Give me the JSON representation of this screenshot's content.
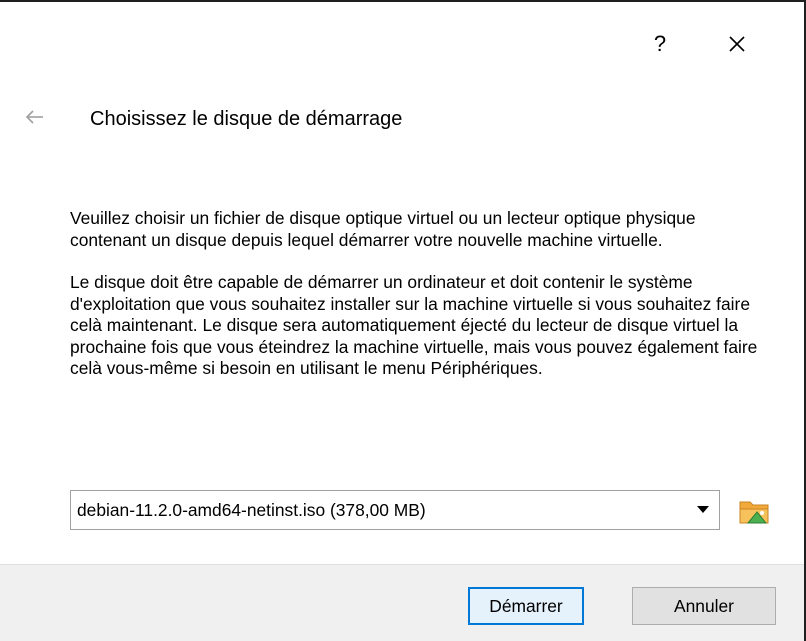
{
  "titlebar": {
    "help_label": "?"
  },
  "header": {
    "title": "Choisissez le disque de démarrage"
  },
  "content": {
    "paragraph1": "Veuillez choisir un fichier de disque optique virtuel ou un lecteur optique physique contenant un disque depuis lequel démarrer votre nouvelle machine virtuelle.",
    "paragraph2": "Le disque doit être capable de démarrer un ordinateur et doit contenir le système d'exploitation que vous souhaitez installer sur la machine virtuelle si vous souhaitez faire celà maintenant. Le disque sera automatiquement éjecté du lecteur de disque virtuel la prochaine fois que vous éteindrez la machine virtuelle, mais vous pouvez également faire celà vous-même si besoin en utilisant le menu Périphériques."
  },
  "disk_selector": {
    "selected": "debian-11.2.0-amd64-netinst.iso (378,00 MB)"
  },
  "footer": {
    "start_label": "Démarrer",
    "cancel_label": "Annuler"
  },
  "icons": {
    "close": "close-icon",
    "back": "back-arrow-icon",
    "dropdown": "chevron-down-icon",
    "folder": "folder-open-icon"
  },
  "colors": {
    "default_button_border": "#0078d7",
    "footer_background": "#f0f0f0",
    "folder_orange": "#f2a93b",
    "folder_green": "#4caf50"
  }
}
